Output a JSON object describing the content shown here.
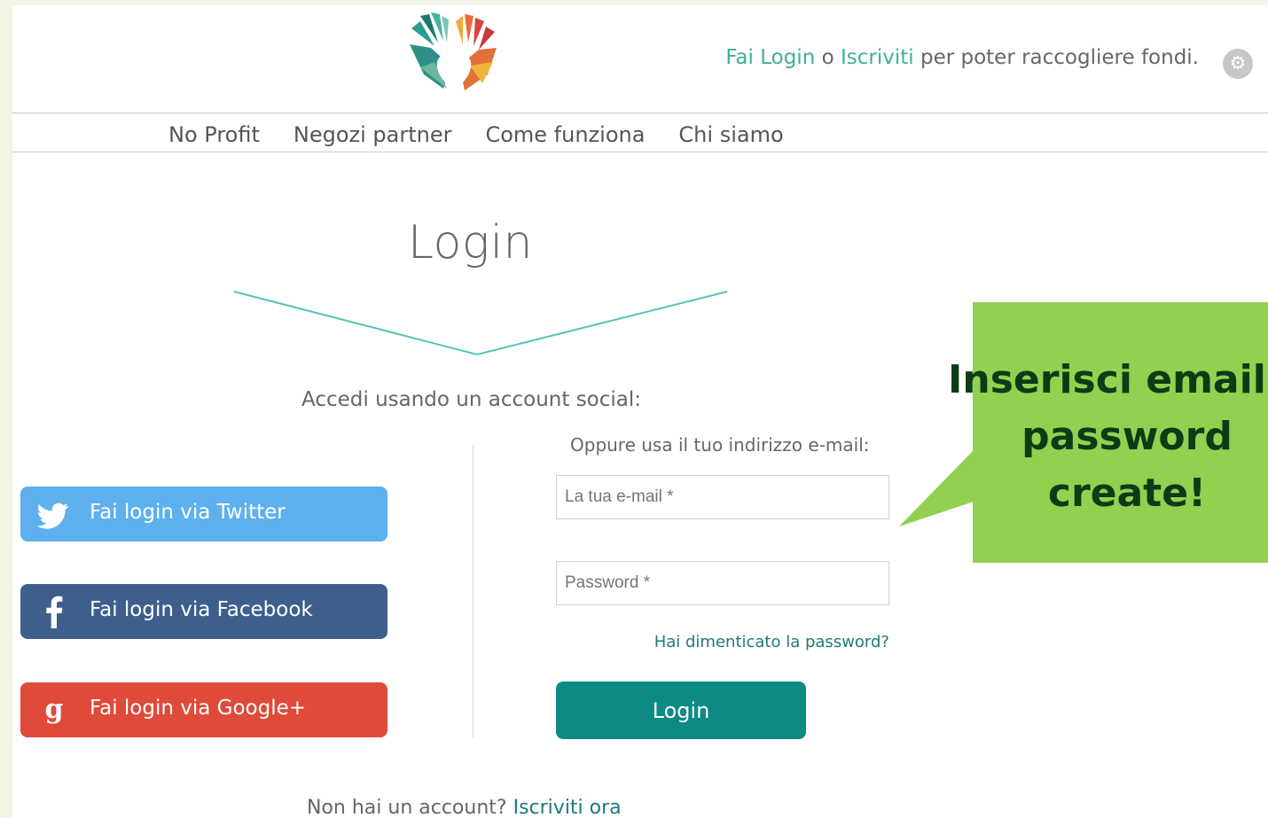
{
  "header": {
    "login_link": "Fai Login",
    "or_word": "o",
    "signup_link": "Iscriviti",
    "suffix": "per poter raccogliere fondi.",
    "settings_icon": "gear-icon",
    "logo_icon": "hands-heart-logo"
  },
  "nav": {
    "items": [
      {
        "label": "No Profit"
      },
      {
        "label": "Negozi partner"
      },
      {
        "label": "Come funziona"
      },
      {
        "label": "Chi siamo"
      }
    ]
  },
  "page": {
    "title": "Login"
  },
  "social": {
    "heading": "Accedi usando un account social:",
    "twitter": {
      "label": "Fai login via Twitter",
      "icon": "twitter-bird-icon",
      "color": "#5eb1ee"
    },
    "facebook": {
      "label": "Fai login via Facebook",
      "icon": "facebook-f-icon",
      "color": "#3e5f8c"
    },
    "google": {
      "label": "Fai login via Google+",
      "icon": "google-plus-g-icon",
      "color": "#df4a39"
    }
  },
  "email_form": {
    "heading": "Oppure usa il tuo indirizzo e-mail:",
    "email_placeholder": "La tua e-mail *",
    "password_placeholder": "Password *",
    "forgot_link": "Hai dimenticato la password?",
    "login_button": "Login"
  },
  "footer": {
    "question": "Non hai un account?",
    "signup_now": "Iscriviti ora"
  },
  "callout": {
    "text": "Inserisci email e\npassword\ncreate!",
    "color": "#92d050"
  },
  "colors": {
    "accent": "#3fae9b",
    "primary_button": "#0e8a84"
  }
}
